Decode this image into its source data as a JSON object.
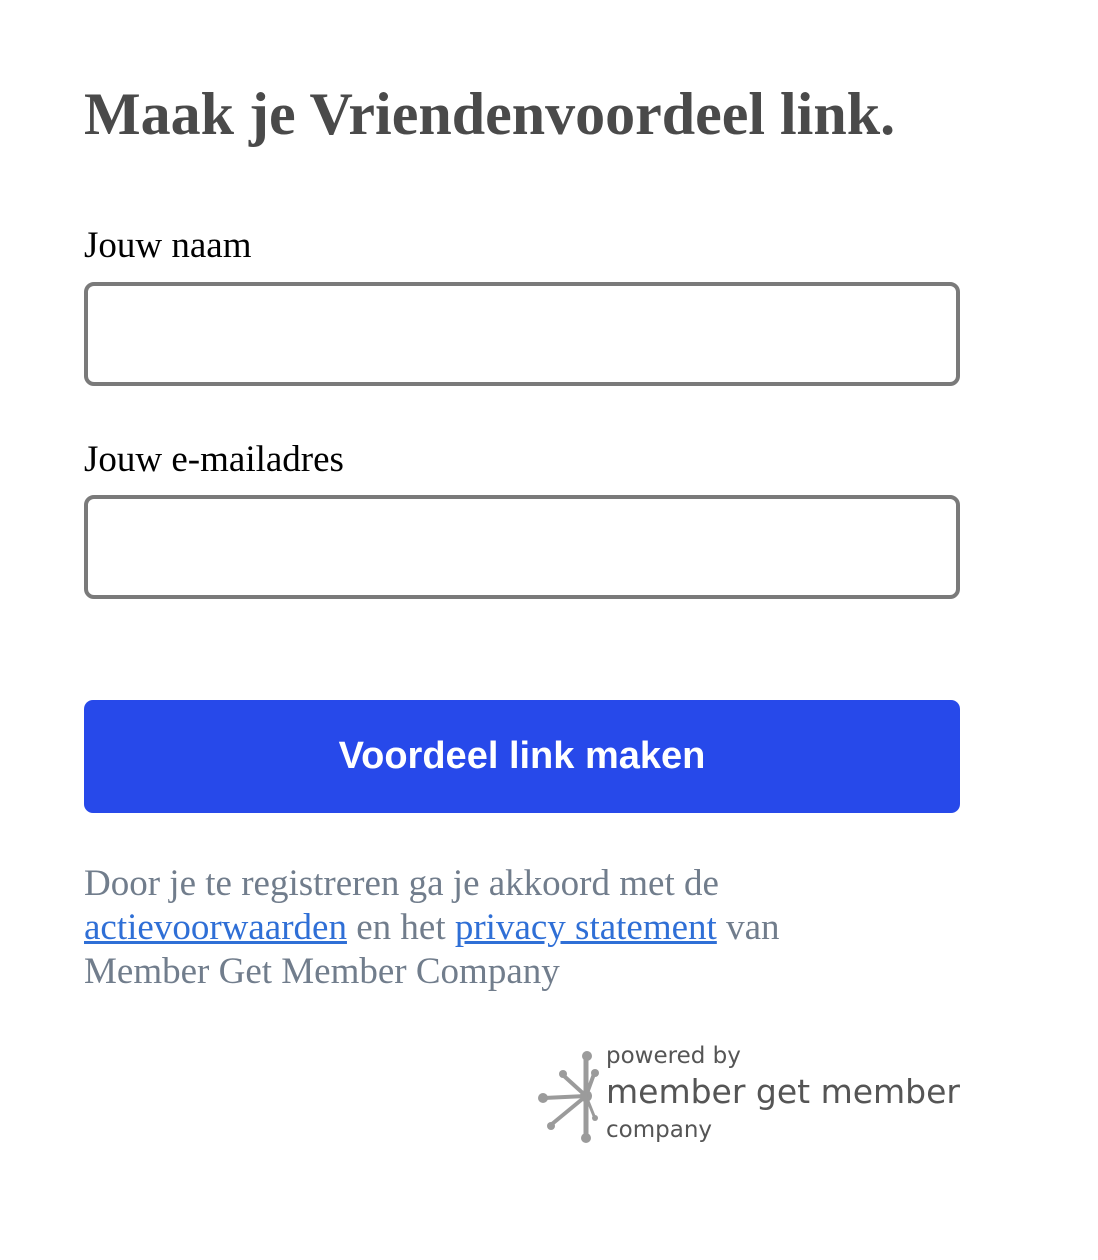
{
  "form": {
    "title": "Maak je Vriendenvoordeel link.",
    "name_label": "Jouw naam",
    "name_value": "",
    "email_label": "Jouw e-mailadres",
    "email_value": "",
    "submit_label": "Voordeel link maken"
  },
  "disclaimer": {
    "text_before": "Door je te registreren ga je akkoord met de ",
    "terms_link": "actievoorwaarden",
    "text_middle": " en het ",
    "privacy_link": "privacy statement",
    "text_after": " van Member Get Member Company"
  },
  "footer": {
    "powered_by": "powered by",
    "brand_name": "member get member",
    "brand_suffix": "company",
    "logo_icon": "member-get-member-logo"
  },
  "colors": {
    "button": "#2749ea",
    "link": "#2f6fd6",
    "muted_text": "#717d8c",
    "title_text": "#4a4a4a",
    "input_border": "#7a7a7a"
  }
}
